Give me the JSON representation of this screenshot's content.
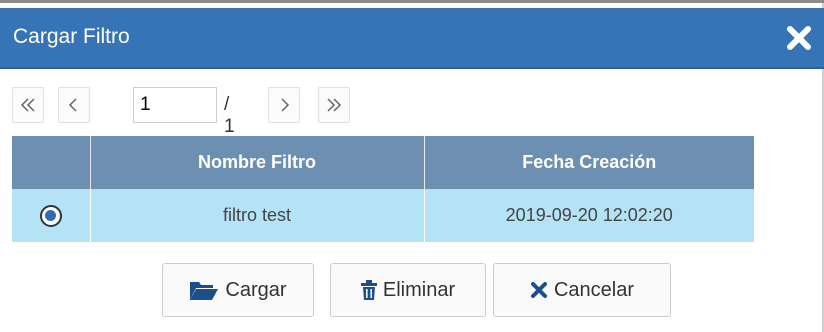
{
  "dialog": {
    "title": "Cargar Filtro"
  },
  "pager": {
    "current_page": "1",
    "total": "/ 1"
  },
  "table": {
    "columns": [
      "",
      "Nombre Filtro",
      "Fecha Creación"
    ],
    "rows": [
      {
        "selected": true,
        "nombre": "filtro test",
        "fecha": "2019-09-20 12:02:20"
      }
    ]
  },
  "buttons": {
    "cargar": "Cargar",
    "eliminar": "Eliminar",
    "cancelar": "Cancelar"
  },
  "colors": {
    "titlebar": "#3774b5",
    "table_header": "#6d8fb1",
    "selected_row": "#b5e3f6"
  },
  "icons": {
    "close": "close-icon",
    "cargar": "folder-open-icon",
    "eliminar": "trash-icon",
    "cancelar": "x-icon"
  }
}
